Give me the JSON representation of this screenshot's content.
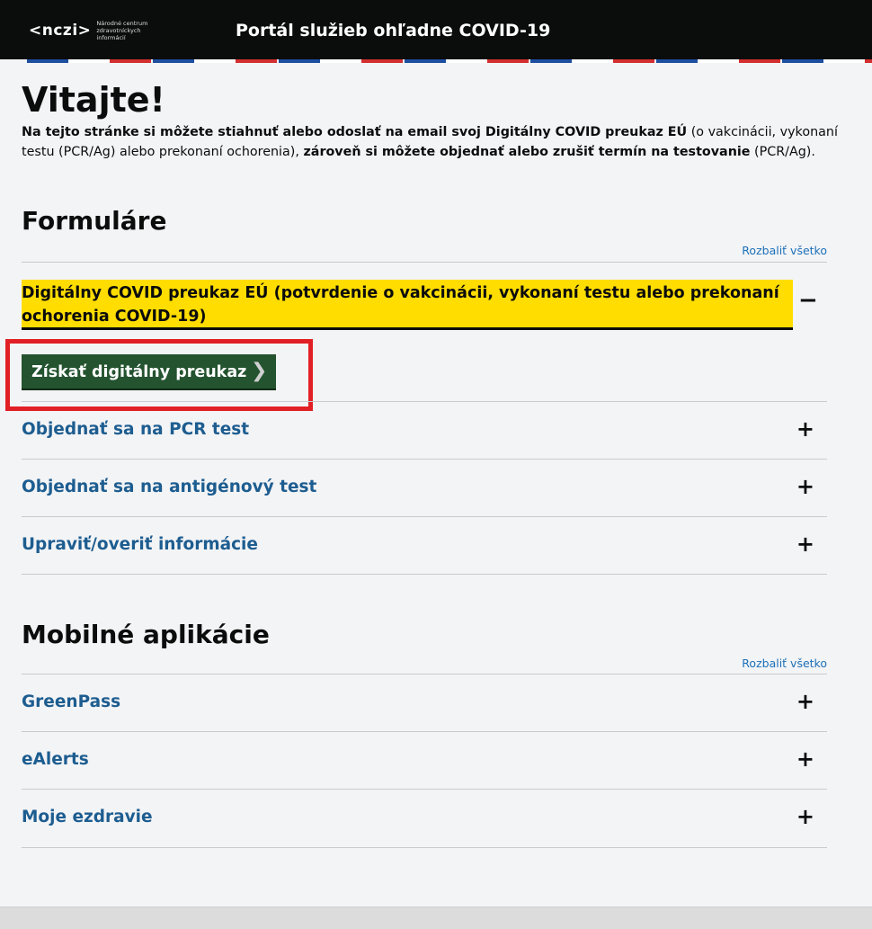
{
  "header": {
    "logo_mark": "<nczi>",
    "logo_subtitle": "Národné centrum zdravotníckych informácií",
    "portal_title": "Portál služieb ohľadne COVID-19"
  },
  "welcome": {
    "title": "Vitajte!",
    "intro_bold_1": "Na tejto stránke si môžete stiahnuť alebo odoslať na email svoj Digitálny COVID preukaz EÚ",
    "intro_text_1": " (o vakcinácii, vykonaní testu (PCR/Ag) alebo prekonaní ochorenia), ",
    "intro_bold_2": "zároveň si môžete objednať alebo zrušiť termín na testovanie",
    "intro_text_2": " (PCR/Ag)."
  },
  "forms": {
    "heading": "Formuláre",
    "expand_all": "Rozbaliť všetko",
    "open_item": {
      "title": "Digitálny COVID preukaz EÚ (potvrdenie o vakcinácii, vykonaní testu alebo prekonaní ochorenia COVID-19)",
      "sign": "−",
      "button_label": "Získať digitálny preukaz"
    },
    "items": [
      {
        "label": "Objednať sa na PCR test",
        "sign": "+"
      },
      {
        "label": "Objednať sa na antigénový test",
        "sign": "+"
      },
      {
        "label": "Upraviť/overiť informácie",
        "sign": "+"
      }
    ]
  },
  "apps": {
    "heading": "Mobilné aplikácie",
    "expand_all": "Rozbaliť všetko",
    "items": [
      {
        "label": "GreenPass",
        "sign": "+"
      },
      {
        "label": "eAlerts",
        "sign": "+"
      },
      {
        "label": "Moje ezdravie",
        "sign": "+"
      }
    ]
  },
  "colors": {
    "header_bg": "#0b0c0c",
    "highlight_yellow": "#ffdd00",
    "button_green": "#23532f",
    "link_blue": "#1d5d90",
    "annotation_red": "#e12026",
    "stripe_blue": "#1d4fa0",
    "stripe_red": "#d32f2f"
  }
}
